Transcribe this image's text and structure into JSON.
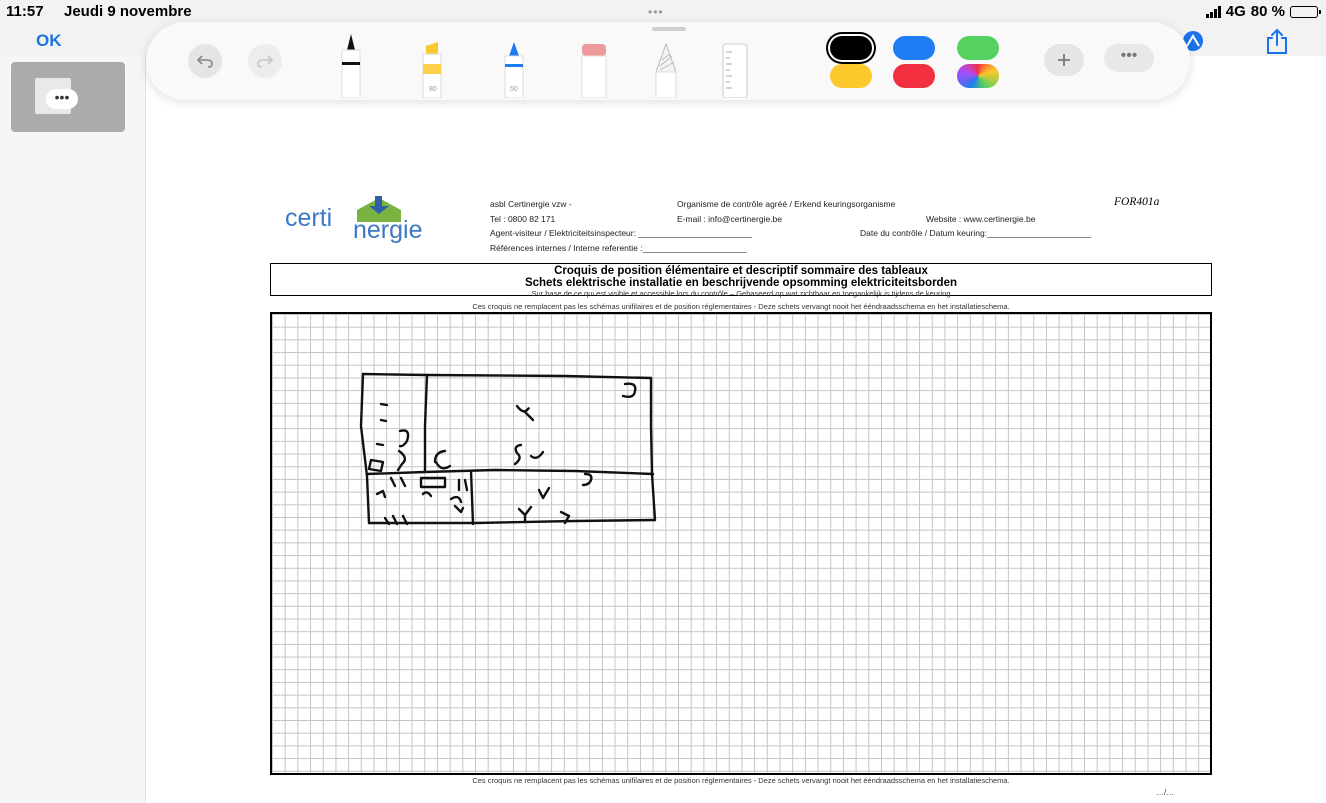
{
  "status_bar": {
    "time": "11:57",
    "date": "Jeudi 9 novembre",
    "network": "4G",
    "battery": "80 %",
    "battery_level": 0.8
  },
  "nav": {
    "ok_label": "OK"
  },
  "toolbar": {
    "tools": [
      {
        "name": "pen",
        "label": ""
      },
      {
        "name": "highlighter",
        "label": "80"
      },
      {
        "name": "pencil",
        "label": "50"
      },
      {
        "name": "eraser",
        "label": ""
      },
      {
        "name": "lasso",
        "label": ""
      },
      {
        "name": "ruler",
        "label": ""
      }
    ],
    "colors": [
      "#000000",
      "#1f7cf2",
      "#55d15f",
      "#fcc82b",
      "#f22f3e",
      "rainbow"
    ],
    "selected_color": "#000000"
  },
  "document": {
    "header": {
      "org": "asbl Certinergie vzw   -",
      "org_type": "Organisme de contrôle agréé /  Erkend keuringsorganisme",
      "form_code": "FOR401a",
      "tel": "Tel : 0800 82 171",
      "email": "E-mail : info@certinergie.be",
      "website": "Website : www.certinergie.be",
      "agent": "Agent-visiteur / Elektriciteitsinspecteur: ________________________",
      "date": "Date du contrôle / Datum keuring:______________________",
      "references": "Références internes / Interne referentie :______________________"
    },
    "logo": {
      "part1": "certi",
      "part2": "nergie"
    },
    "title_fr": "Croquis de position élémentaire et descriptif sommaire des tableaux",
    "title_nl": "Schets elektrische installatie en beschrijvende opsomming elektriciteitsborden",
    "subtitle": "Sur base de ce qui est visible et accessible lors du contrôle – Gebaseerd op wat zichtbaar en toegankelijk is tijdens de keuring",
    "note_top": "Ces croquis ne remplacent pas les schémas unifilaires et de position réglementaires - Deze schets vervangt nooit het ééndraadsschema en het installatieschema.",
    "note_bottom": "Ces croquis ne remplacent pas les schémas unifilaires et de position réglementaires - Deze schets vervangt nooit het ééndraadsschema en het installatieschema.",
    "page_marker": "…/…"
  },
  "sidebar": {
    "thumbnail_menu": "•••"
  }
}
